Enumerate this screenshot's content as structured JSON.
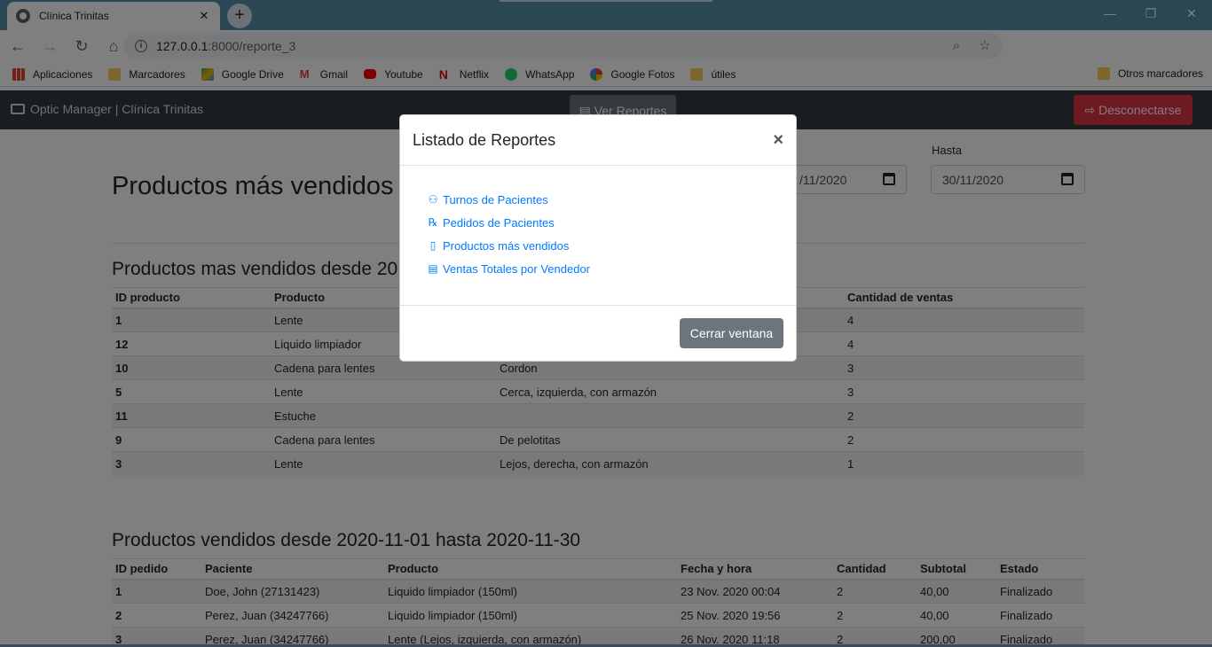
{
  "browser": {
    "tab_title": "Clínica Trinitas",
    "url_host": "127.0.0.1",
    "url_rest": ":8000/reporte_3",
    "bookmarks": [
      "Aplicaciones",
      "Marcadores",
      "Google Drive",
      "Gmail",
      "Youtube",
      "Netflix",
      "WhatsApp",
      "Google Fotos",
      "útiles"
    ],
    "other_bookmarks": "Otros marcadores",
    "avatar_letter": "M"
  },
  "navbar": {
    "brand": "Optic Manager | Clínica Trinitas",
    "reports_button": "Ver Reportes",
    "logout_button": "Desconectarse"
  },
  "page": {
    "title": "Productos más vendidos",
    "date_from_value": "/11/2020",
    "date_to_label": "Hasta",
    "date_to_value": "30/11/2020"
  },
  "table1": {
    "title": "Productos mas vendidos desde 20",
    "headers": [
      "ID producto",
      "Producto",
      "",
      "Cantidad de ventas"
    ],
    "rows": [
      [
        "1",
        "Lente",
        "",
        "4"
      ],
      [
        "12",
        "Liquido limpiador",
        "",
        "4"
      ],
      [
        "10",
        "Cadena para lentes",
        "Cordon",
        "3"
      ],
      [
        "5",
        "Lente",
        "Cerca, izquierda, con armazón",
        "3"
      ],
      [
        "11",
        "Estuche",
        "",
        "2"
      ],
      [
        "9",
        "Cadena para lentes",
        "De pelotitas",
        "2"
      ],
      [
        "3",
        "Lente",
        "Lejos, derecha, con armazón",
        "1"
      ]
    ]
  },
  "table2": {
    "title": "Productos vendidos desde 2020-11-01 hasta 2020-11-30",
    "headers": [
      "ID pedido",
      "Paciente",
      "Producto",
      "Fecha y hora",
      "Cantidad",
      "Subtotal",
      "Estado"
    ],
    "rows": [
      [
        "1",
        "Doe, John (27131423)",
        "Liquido limpiador (150ml)",
        "23 Nov. 2020 00:04",
        "2",
        "40,00",
        "Finalizado"
      ],
      [
        "2",
        "Perez, Juan (34247766)",
        "Liquido limpiador (150ml)",
        "25 Nov. 2020 19:56",
        "2",
        "40,00",
        "Finalizado"
      ],
      [
        "3",
        "Perez, Juan (34247766)",
        "Lente (Lejos, izquierda, con armazón)",
        "26 Nov. 2020 11:18",
        "2",
        "200,00",
        "Finalizado"
      ]
    ]
  },
  "modal": {
    "title": "Listado de Reportes",
    "links": [
      "Turnos de Pacientes",
      "Pedidos de Pacientes",
      "Productos más vendidos",
      "Ventas Totales por Vendedor"
    ],
    "close_button": "Cerrar ventana"
  }
}
